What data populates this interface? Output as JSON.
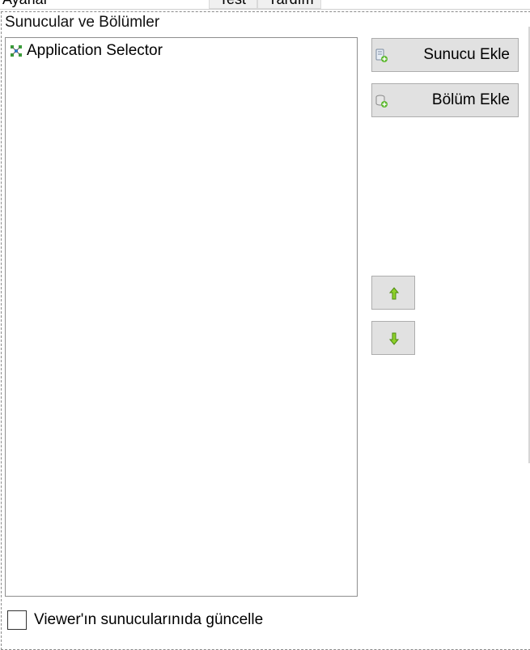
{
  "tabs": [
    {
      "label": "Ayarlar"
    },
    {
      "label": "Test"
    },
    {
      "label": "Yardım"
    }
  ],
  "group": {
    "title": "Sunucular ve Bölümler"
  },
  "tree": {
    "items": [
      {
        "label": "Application Selector",
        "icon": "app-selector-icon"
      }
    ]
  },
  "buttons": {
    "add_server": "Sunucu Ekle",
    "add_section": "Bölüm Ekle",
    "move_up_icon": "arrow-up-icon",
    "move_down_icon": "arrow-down-icon"
  },
  "checkbox": {
    "label": "Viewer'ın sunucularınıda güncelle",
    "checked": false
  },
  "colors": {
    "button_bg": "#e1e1e1",
    "arrow_green": "#6fbf1f"
  }
}
